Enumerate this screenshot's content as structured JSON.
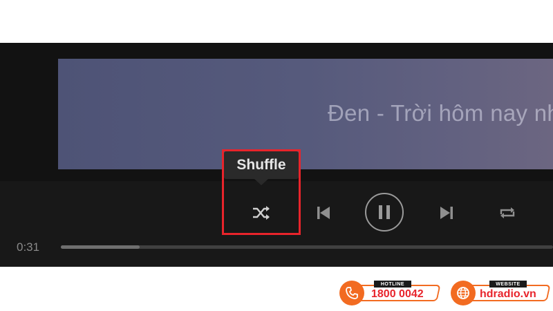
{
  "player": {
    "banner_text": "Đen - Trời hôm nay nhi",
    "tooltip": "Shuffle",
    "time_elapsed": "0:31",
    "progress_fraction": 0.16,
    "icons": {
      "shuffle": "shuffle-icon",
      "previous": "skip-previous-icon",
      "pause": "pause-icon",
      "next": "skip-next-icon",
      "repeat": "repeat-icon"
    }
  },
  "annotation": {
    "highlight_color": "#e8242b"
  },
  "branding": {
    "hotline": {
      "caption": "HOTLINE",
      "value": "1800 0042"
    },
    "website": {
      "caption": "WEBSITE",
      "value": "hdradio.vn"
    },
    "accent": "#f26b21"
  }
}
